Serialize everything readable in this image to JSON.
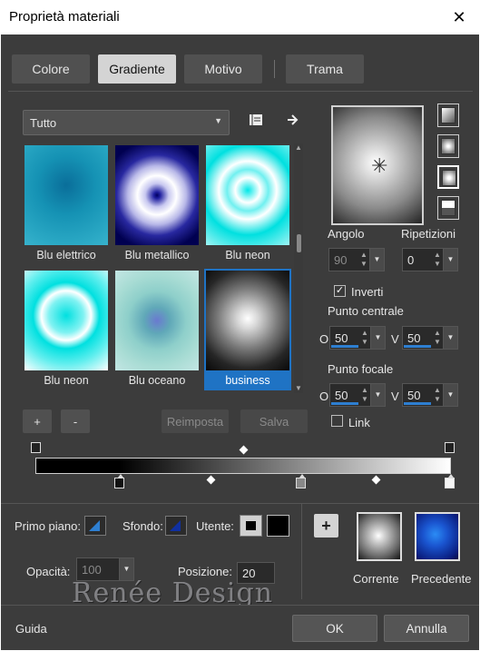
{
  "window": {
    "title": "Proprietà materiali",
    "close_icon": "close-icon"
  },
  "tabs": [
    {
      "label": "Colore",
      "active": false
    },
    {
      "label": "Gradiente",
      "active": true
    },
    {
      "label": "Motivo",
      "active": false
    },
    {
      "label": "Trama",
      "active": false
    }
  ],
  "category": {
    "selected": "Tutto"
  },
  "gallery": [
    {
      "label": "Blu elettrico"
    },
    {
      "label": "Blu metallico"
    },
    {
      "label": "Blu neon"
    },
    {
      "label": "Blu neon"
    },
    {
      "label": "Blu oceano"
    },
    {
      "label": "business",
      "selected": true
    }
  ],
  "buttons": {
    "add": "+",
    "remove": "-",
    "reset": "Reimposta",
    "save": "Salva"
  },
  "angle": {
    "label": "Angolo",
    "value": "90"
  },
  "repeats": {
    "label": "Ripetizioni",
    "value": "0"
  },
  "invert": {
    "label": "Inverti",
    "checked": true
  },
  "center_point": {
    "label": "Punto centrale",
    "h_label": "O",
    "h_value": "50",
    "v_label": "V",
    "v_value": "50"
  },
  "focal_point": {
    "label": "Punto focale",
    "h_label": "O",
    "h_value": "50",
    "v_label": "V",
    "v_value": "50"
  },
  "link": {
    "label": "Link",
    "checked": false
  },
  "bottom": {
    "foreground_label": "Primo piano:",
    "background_label": "Sfondo:",
    "user_label": "Utente:",
    "opacity_label": "Opacità:",
    "opacity_value": "100",
    "position_label": "Posizione:",
    "position_value": "20",
    "current_label": "Corrente",
    "previous_label": "Precedente",
    "add_icon": "+"
  },
  "watermark": "Renée Design",
  "footer": {
    "help": "Guida",
    "ok": "OK",
    "cancel": "Annulla"
  },
  "colors": {
    "accent": "#1f73c4",
    "dialog_bg": "#3c3c3c"
  }
}
